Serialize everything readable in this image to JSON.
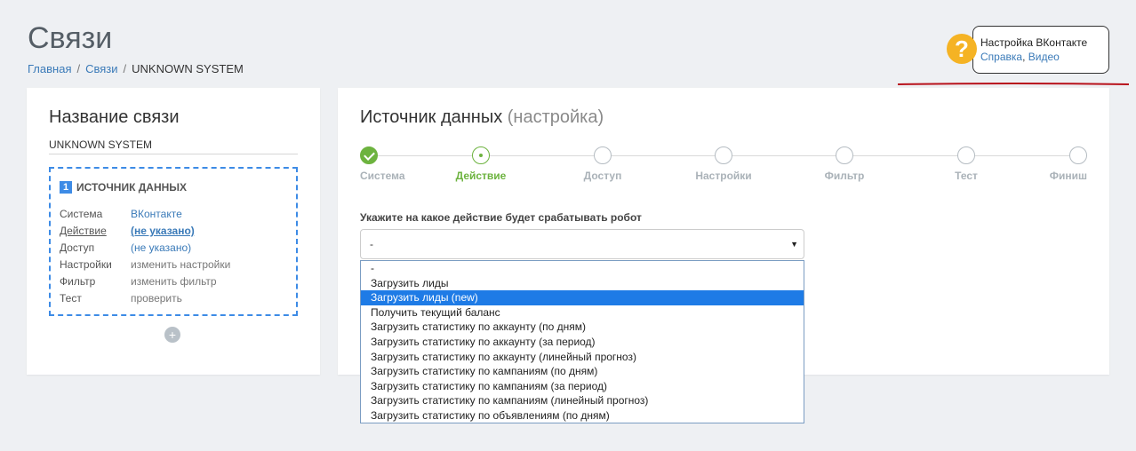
{
  "page": {
    "title": "Связи",
    "breadcrumb": {
      "home": "Главная",
      "section": "Связи",
      "current": "UNKNOWN SYSTEM"
    }
  },
  "help": {
    "icon": "question-icon",
    "title": "Настройка ВКонтакте",
    "link_help": "Справка",
    "comma": ",",
    "link_video": "Видео",
    "accent": "#f5b324"
  },
  "left_card": {
    "title": "Название связи",
    "connection_name": "UNKNOWN SYSTEM",
    "source": {
      "number": "1",
      "header": "ИСТОЧНИК ДАННЫХ",
      "rows": [
        {
          "key": "Система",
          "value": "ВКонтакте"
        },
        {
          "key": "Действие",
          "value": "(не указано)"
        },
        {
          "key": "Доступ",
          "value": "(не указано)"
        },
        {
          "key": "Настройки",
          "value": "изменить настройки"
        },
        {
          "key": "Фильтр",
          "value": "изменить фильтр"
        },
        {
          "key": "Тест",
          "value": "проверить"
        }
      ]
    },
    "add_button": "+"
  },
  "right_card": {
    "title": "Источник данных",
    "title_sub": "(настройка)",
    "steps": [
      {
        "label": "Система",
        "state": "done"
      },
      {
        "label": "Действие",
        "state": "active"
      },
      {
        "label": "Доступ",
        "state": "todo"
      },
      {
        "label": "Настройки",
        "state": "todo"
      },
      {
        "label": "Фильтр",
        "state": "todo"
      },
      {
        "label": "Тест",
        "state": "todo"
      },
      {
        "label": "Финиш",
        "state": "todo"
      }
    ],
    "question": "Укажите на какое действие будет срабатывать робот",
    "select_value": "-",
    "options": [
      "-",
      "Загрузить лиды",
      "Загрузить лиды (new)",
      "Получить текущий баланс",
      "Загрузить статистику по аккаунту (по дням)",
      "Загрузить статистику по аккаунту (за период)",
      "Загрузить статистику по аккаунту (линейный прогноз)",
      "Загрузить статистику по кампаниям (по дням)",
      "Загрузить статистику по кампаниям (за период)",
      "Загрузить статистику по кампаниям (линейный прогноз)",
      "Загрузить статистику по объявлениям (по дням)"
    ],
    "highlighted_option": "Загрузить лиды (new)"
  },
  "colors": {
    "green": "#6db33f",
    "blue": "#3d8be6",
    "highlight": "#1e7be6",
    "annotation_red": "#b8121b"
  }
}
